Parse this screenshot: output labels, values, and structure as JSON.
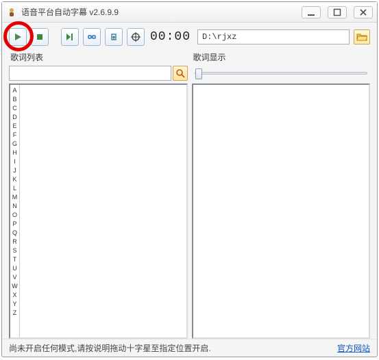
{
  "titlebar": {
    "title": "语音平台自动字幕 v2.6.9.9"
  },
  "toolbar": {
    "time": "00:00",
    "path": "D:\\rjxz"
  },
  "left_panel": {
    "header": "歌词列表",
    "alphabet": [
      "A",
      "B",
      "C",
      "D",
      "E",
      "F",
      "G",
      "H",
      "I",
      "J",
      "K",
      "L",
      "M",
      "N",
      "O",
      "P",
      "Q",
      "R",
      "S",
      "T",
      "U",
      "V",
      "W",
      "X",
      "Y",
      "Z"
    ]
  },
  "right_panel": {
    "header": "歌词显示"
  },
  "status": {
    "message": "尚未开启任何模式,请按说明拖动十字星至指定位置开启.",
    "link": "官方网站"
  }
}
